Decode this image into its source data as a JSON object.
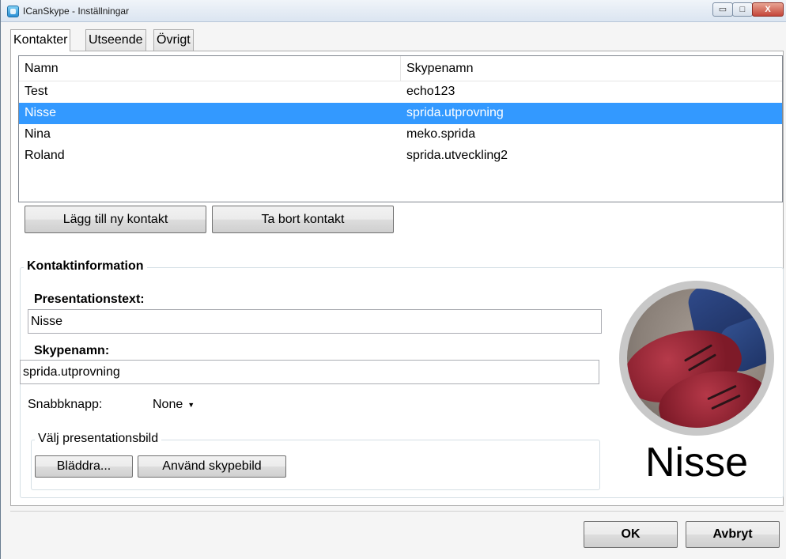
{
  "window": {
    "title": "ICanSkype - Inställningar",
    "min_glyph": "▭",
    "max_glyph": "□",
    "close_glyph": "X"
  },
  "tabs": [
    {
      "label": "Kontakter",
      "active": true
    },
    {
      "label": "Utseende",
      "active": false
    },
    {
      "label": "Övrigt",
      "active": false
    }
  ],
  "contacts": {
    "columns": [
      "Namn",
      "Skypenamn"
    ],
    "rows": [
      {
        "name": "Test",
        "skype": "echo123"
      },
      {
        "name": "Nisse",
        "skype": "sprida.utprovning"
      },
      {
        "name": "Nina",
        "skype": "meko.sprida"
      },
      {
        "name": "Roland",
        "skype": "sprida.utveckling2"
      }
    ],
    "selected_index": 1
  },
  "buttons": {
    "add_contact": "Lägg till ny kontakt",
    "remove_contact": "Ta bort kontakt",
    "browse": "Bläddra...",
    "use_skype_picture": "Använd skypebild",
    "ok": "OK",
    "cancel": "Avbryt"
  },
  "contact_info": {
    "group_title": "Kontaktinformation",
    "presentation_label": "Presentationstext:",
    "presentation_value": "Nisse",
    "skype_label": "Skypenamn:",
    "skype_value": "sprida.utprovning",
    "hotkey_label": "Snabbknapp:",
    "hotkey_value": "None",
    "picture_group_title": "Välj presentationsbild",
    "display_name": "Nisse"
  },
  "colors": {
    "selection": "#3399ff"
  }
}
